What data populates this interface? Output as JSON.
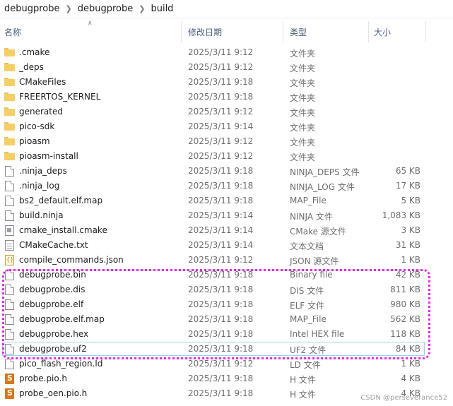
{
  "breadcrumb": [
    "debugprobe",
    "debugprobe",
    "build"
  ],
  "columns": {
    "name": "名称",
    "date": "修改日期",
    "type": "类型",
    "size": "大小"
  },
  "files": [
    {
      "name": ".cmake",
      "date": "2025/3/11 9:12",
      "type": "文件夹",
      "size": "",
      "icon": "folder-icon"
    },
    {
      "name": "_deps",
      "date": "2025/3/11 9:12",
      "type": "文件夹",
      "size": "",
      "icon": "folder-icon"
    },
    {
      "name": "CMakeFiles",
      "date": "2025/3/11 9:18",
      "type": "文件夹",
      "size": "",
      "icon": "folder-icon"
    },
    {
      "name": "FREERTOS_KERNEL",
      "date": "2025/3/11 9:18",
      "type": "文件夹",
      "size": "",
      "icon": "folder-icon"
    },
    {
      "name": "generated",
      "date": "2025/3/11 9:12",
      "type": "文件夹",
      "size": "",
      "icon": "folder-icon"
    },
    {
      "name": "pico-sdk",
      "date": "2025/3/11 9:14",
      "type": "文件夹",
      "size": "",
      "icon": "folder-icon"
    },
    {
      "name": "pioasm",
      "date": "2025/3/11 9:12",
      "type": "文件夹",
      "size": "",
      "icon": "folder-icon"
    },
    {
      "name": "pioasm-install",
      "date": "2025/3/11 9:12",
      "type": "文件夹",
      "size": "",
      "icon": "folder-icon"
    },
    {
      "name": ".ninja_deps",
      "date": "2025/3/11 9:18",
      "type": "NINJA_DEPS 文件",
      "size": "65 KB",
      "icon": "file-icon"
    },
    {
      "name": ".ninja_log",
      "date": "2025/3/11 9:18",
      "type": "NINJA_LOG 文件",
      "size": "17 KB",
      "icon": "file-icon"
    },
    {
      "name": "bs2_default.elf.map",
      "date": "2025/3/11 9:18",
      "type": "MAP_File",
      "size": "5 KB",
      "icon": "file-icon"
    },
    {
      "name": "build.ninja",
      "date": "2025/3/11 9:14",
      "type": "NINJA 文件",
      "size": "1,083 KB",
      "icon": "file-icon"
    },
    {
      "name": "cmake_install.cmake",
      "date": "2025/3/11 9:14",
      "type": "CMake 源文件",
      "size": "3 KB",
      "icon": "cmake-file-icon"
    },
    {
      "name": "CMakeCache.txt",
      "date": "2025/3/11 9:14",
      "type": "文本文档",
      "size": "31 KB",
      "icon": "text-file-icon"
    },
    {
      "name": "compile_commands.json",
      "date": "2025/3/11 9:12",
      "type": "JSON 源文件",
      "size": "1 KB",
      "icon": "json-file-icon"
    },
    {
      "name": "debugprobe.bin",
      "date": "2025/3/11 9:18",
      "type": "Binary file",
      "size": "42 KB",
      "icon": "file-icon"
    },
    {
      "name": "debugprobe.dis",
      "date": "2025/3/11 9:18",
      "type": "DIS 文件",
      "size": "811 KB",
      "icon": "file-icon"
    },
    {
      "name": "debugprobe.elf",
      "date": "2025/3/11 9:18",
      "type": "ELF 文件",
      "size": "980 KB",
      "icon": "file-icon"
    },
    {
      "name": "debugprobe.elf.map",
      "date": "2025/3/11 9:18",
      "type": "MAP_File",
      "size": "562 KB",
      "icon": "file-icon"
    },
    {
      "name": "debugprobe.hex",
      "date": "2025/3/11 9:18",
      "type": "Intel HEX file",
      "size": "118 KB",
      "icon": "file-icon"
    },
    {
      "name": "debugprobe.uf2",
      "date": "2025/3/11 9:18",
      "type": "UF2 文件",
      "size": "84 KB",
      "icon": "file-icon",
      "selected": true
    },
    {
      "name": "pico_flash_region.ld",
      "date": "2025/3/11 9:12",
      "type": "LD 文件",
      "size": "1 KB",
      "icon": "file-icon"
    },
    {
      "name": "probe.pio.h",
      "date": "2025/3/11 9:18",
      "type": "H 文件",
      "size": "4 KB",
      "icon": "header-file-icon"
    },
    {
      "name": "probe_oen.pio.h",
      "date": "2025/3/11 9:18",
      "type": "H 文件",
      "size": "4 KB",
      "icon": "header-file-icon"
    }
  ],
  "watermark": "CSDN @perseverance52",
  "colors": {
    "highlight": "#ee22ee",
    "folder": "#f5cf63",
    "selection_border": "#99d1ff"
  }
}
